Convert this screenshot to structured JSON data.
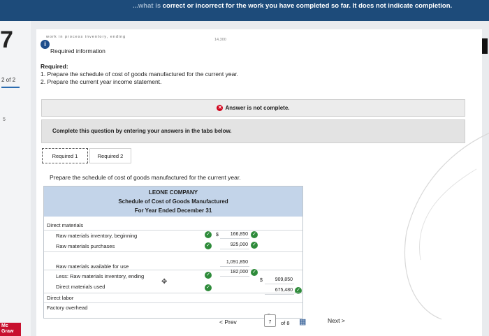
{
  "banner": {
    "prefix": "...what is ",
    "text": "correct or incorrect for the work you have completed so far. It does not indicate completion."
  },
  "sidebar": {
    "question_number": "7",
    "progress": "2 of 2",
    "side_mark": "5"
  },
  "logo": {
    "line1": "Mc",
    "line2": "Graw"
  },
  "header": {
    "blurred_title": "work in process inventory, ending",
    "blurred_right": "14,300",
    "info_icon": "i",
    "required_info": "Required information"
  },
  "required": {
    "heading": "Required:",
    "item1": "1. Prepare the schedule of cost of goods manufactured for the current year.",
    "item2": "2. Prepare the current year income statement."
  },
  "status": {
    "not_complete": "Answer is not complete.",
    "instruction": "Complete this question by entering your answers in the tabs below."
  },
  "tabs": [
    {
      "label": "Required 1"
    },
    {
      "label": "Required 2"
    }
  ],
  "prepare_text": "Prepare the schedule of cost of goods manufactured for the current year.",
  "schedule": {
    "company": "LEONE COMPANY",
    "title": "Schedule of Cost of Goods Manufactured",
    "period": "For Year Ended December 31",
    "rows": {
      "direct_materials": "Direct materials",
      "rm_beginning": "Raw materials inventory, beginning",
      "rm_purchases": "Raw materials purchases",
      "rm_available": "Raw materials available for use",
      "less_rm_ending": "Less: Raw materials inventory, ending",
      "dm_used": "Direct materials used",
      "direct_labor": "Direct labor",
      "factory_overhead": "Factory overhead"
    },
    "values": {
      "currency": "$",
      "rm_beginning": "166,850",
      "rm_purchases": "925,000",
      "rm_available": "1,091,850",
      "less_rm_ending": "182,000",
      "dm_used_a": "909,850",
      "dm_used_b": "675,480"
    }
  },
  "pager": {
    "prev": "< Prev",
    "current": "7",
    "of": "of 8",
    "next": "Next >"
  },
  "colors": {
    "banner": "#1d4b7a",
    "table_header": "#c3d4e9",
    "check": "#2e8b3a",
    "error": "#d0021b"
  }
}
